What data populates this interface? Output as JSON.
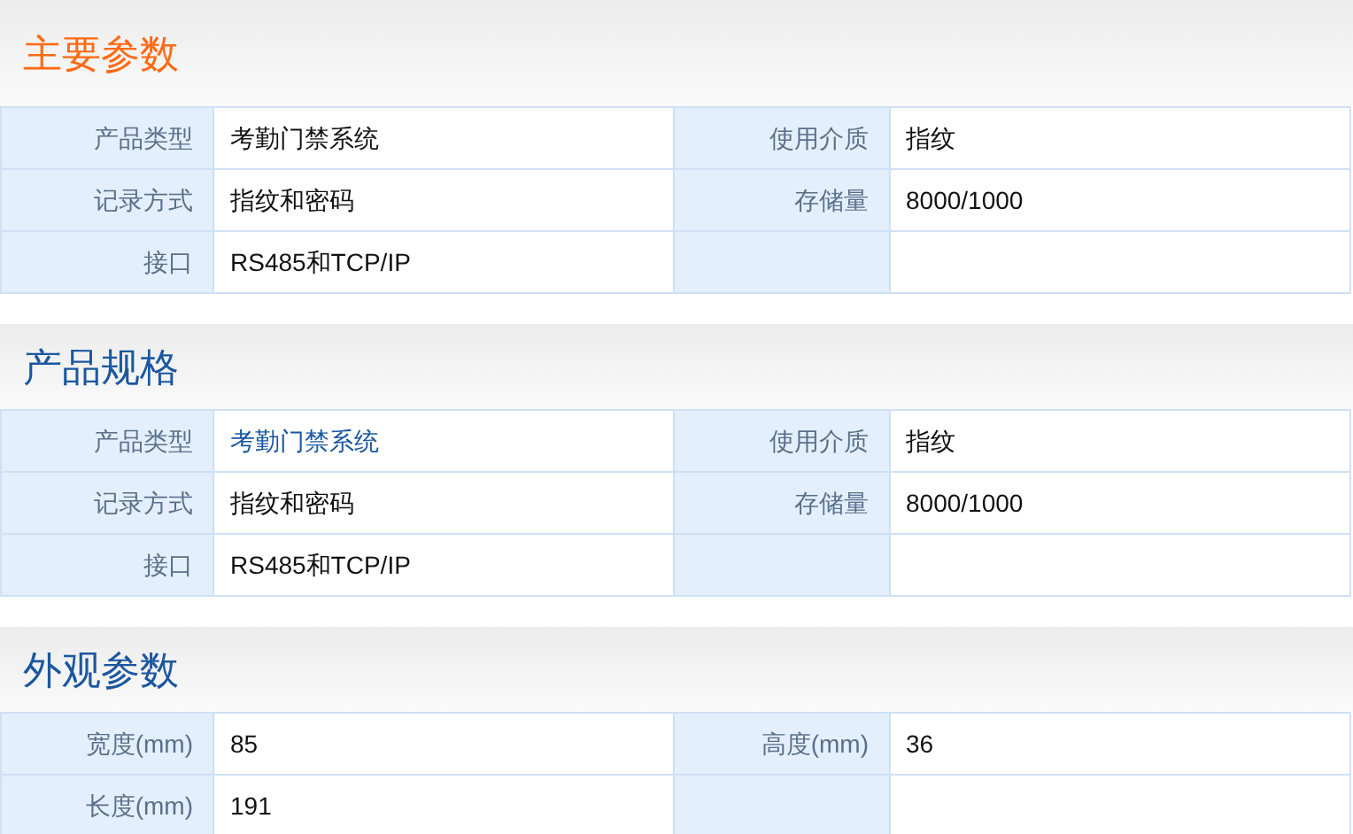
{
  "sections": [
    {
      "title": "主要参数",
      "active": true,
      "rows": [
        [
          {
            "label": "产品类型",
            "value": "考勤门禁系统",
            "link": false
          },
          {
            "label": "使用介质",
            "value": "指纹",
            "link": false
          }
        ],
        [
          {
            "label": "记录方式",
            "value": "指纹和密码",
            "link": false
          },
          {
            "label": "存储量",
            "value": "8000/1000",
            "link": false
          }
        ],
        [
          {
            "label": "接口",
            "value": "RS485和TCP/IP",
            "link": false
          }
        ]
      ]
    },
    {
      "title": "产品规格",
      "active": false,
      "rows": [
        [
          {
            "label": "产品类型",
            "value": "考勤门禁系统",
            "link": true
          },
          {
            "label": "使用介质",
            "value": "指纹",
            "link": false
          }
        ],
        [
          {
            "label": "记录方式",
            "value": "指纹和密码",
            "link": false
          },
          {
            "label": "存储量",
            "value": "8000/1000",
            "link": false
          }
        ],
        [
          {
            "label": "接口",
            "value": "RS485和TCP/IP",
            "link": false
          }
        ]
      ]
    },
    {
      "title": "外观参数",
      "active": false,
      "rows": [
        [
          {
            "label": "宽度(mm)",
            "value": "85",
            "link": false
          },
          {
            "label": "高度(mm)",
            "value": "36",
            "link": false
          }
        ],
        [
          {
            "label": "长度(mm)",
            "value": "191",
            "link": false
          }
        ]
      ]
    }
  ]
}
